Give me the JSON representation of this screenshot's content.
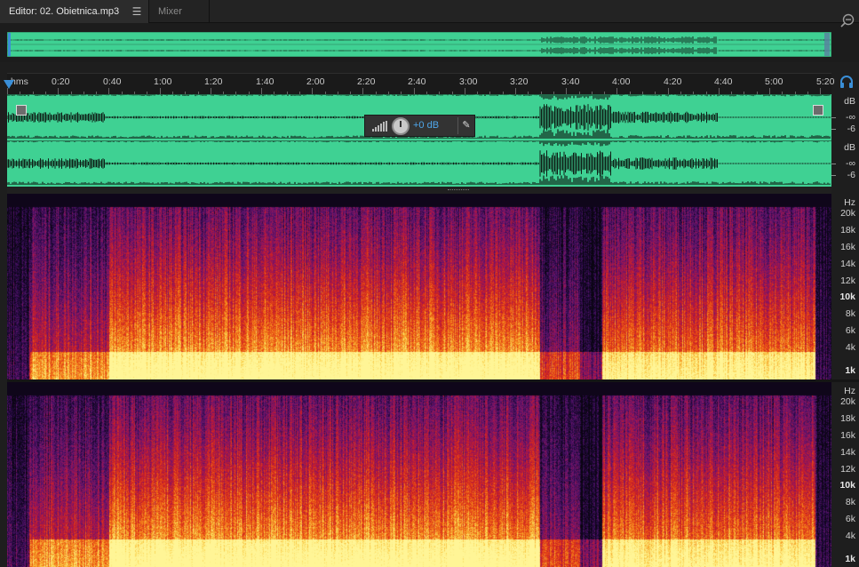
{
  "tabs": {
    "editor": "Editor: 02. Obietnica.mp3",
    "menu_glyph": "☰",
    "mixer": "Mixer"
  },
  "ruler": {
    "labels": [
      "hms",
      "0:20",
      "0:40",
      "1:00",
      "1:20",
      "1:40",
      "2:00",
      "2:20",
      "2:40",
      "3:00",
      "3:20",
      "3:40",
      "4:00",
      "4:20",
      "4:40",
      "5:00",
      "5:20"
    ]
  },
  "hud": {
    "value": "+0 dB",
    "pin_glyph": "✎"
  },
  "db_scale": {
    "labels": [
      "dB",
      "-∞",
      "-6",
      "dB",
      "-∞",
      "-6"
    ]
  },
  "hz_scale": {
    "labels": [
      "Hz",
      "20k",
      "18k",
      "16k",
      "14k",
      "12k",
      "10k",
      "8k",
      "6k",
      "4k",
      "1k"
    ],
    "bold": [
      "10k",
      "1k"
    ]
  },
  "icons": {
    "zoom": "zoom-out-icon",
    "headphones": "headphones-icon",
    "pin": "pin-icon",
    "volume": "volume-bars-icon",
    "knob": "gain-knob-icon"
  },
  "colors": {
    "waveform_bg": "#3fd193",
    "waveform_signal": "#0f1f17",
    "accent_blue": "#4fa6ea",
    "playhead": "#3a8fd8"
  }
}
